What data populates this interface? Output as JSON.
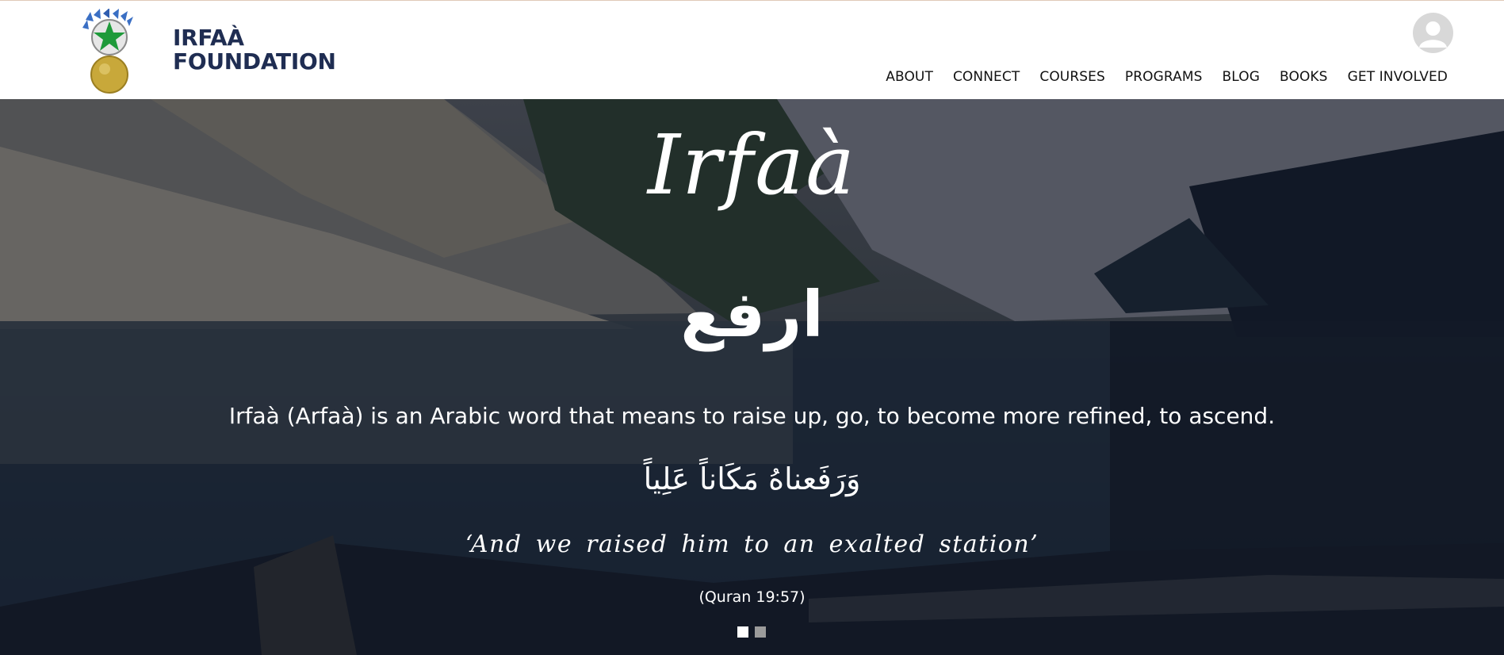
{
  "brand": {
    "line1": "IRFAÀ",
    "line2": "FOUNDATION",
    "logo_icon": "star-medal-logo-icon",
    "color": "#1f2d52"
  },
  "nav": {
    "items": [
      {
        "label": "ABOUT"
      },
      {
        "label": "CONNECT"
      },
      {
        "label": "COURSES"
      },
      {
        "label": "PROGRAMS"
      },
      {
        "label": "BLOG"
      },
      {
        "label": "BOOKS"
      },
      {
        "label": "GET INVOLVED"
      }
    ]
  },
  "account": {
    "icon": "user-avatar-icon"
  },
  "hero": {
    "title": "Irfaà",
    "arabic_word": "ارفع",
    "description": "Irfaà (Arfaà) is an Arabic word that means to raise up, go, to become more refined, to ascend.",
    "verse_arabic": "وَرَفَعناهُ مَكَاناً عَلِياً",
    "translation": "‘And we raised him to an exalted station’",
    "reference": "(Quran 19:57)",
    "slides": {
      "total": 2,
      "active": 1
    }
  }
}
